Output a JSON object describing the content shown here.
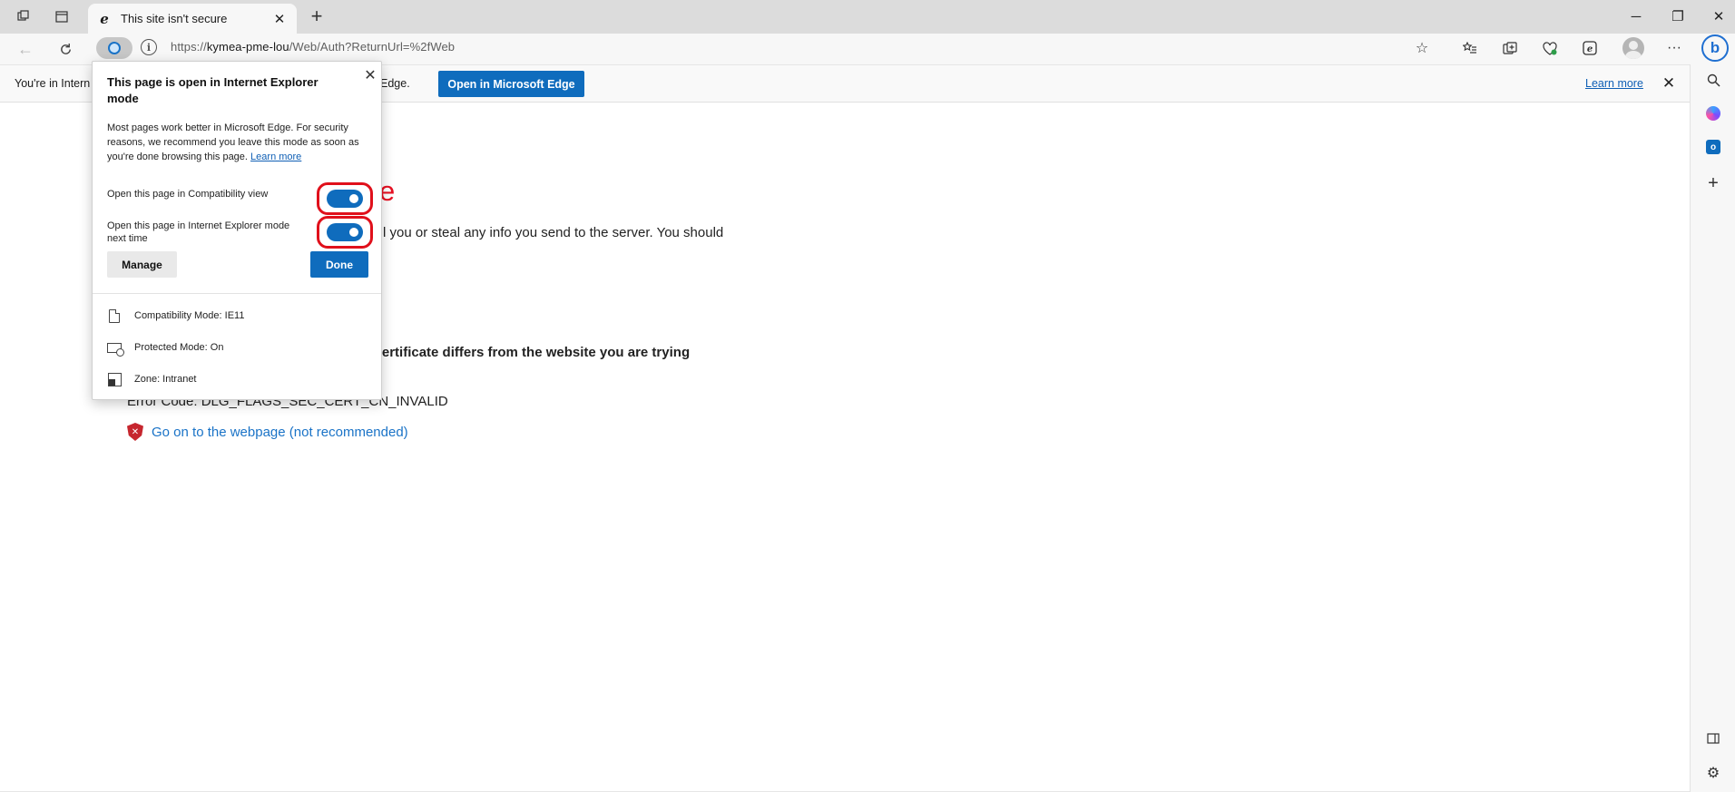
{
  "tab": {
    "title": "This site isn't secure",
    "close": "✕"
  },
  "window": {
    "minimize": "─",
    "restore": "❐",
    "close": "✕"
  },
  "address": {
    "prefix": "https://",
    "host": "kymea-pme-lou",
    "path": "/Web/Auth?ReturnUrl=%2fWeb"
  },
  "infobar": {
    "text_start": "You're in Intern",
    "text_end": "Edge.",
    "open_button": "Open in Microsoft Edge",
    "learn_more": "Learn more"
  },
  "popup": {
    "title": "This page is open in Internet Explorer mode",
    "description": "Most pages work better in Microsoft Edge. For security reasons, we recommend you leave this mode as soon as you're done browsing this page.",
    "learn_more": "Learn more",
    "option_compat": "Open this page in Compatibility view",
    "option_ie_next": "Open this page in Internet Explorer mode next time",
    "compat_on": true,
    "ie_next_on": true,
    "manage_button": "Manage",
    "done_button": "Done",
    "status": [
      {
        "icon": "document-icon",
        "label": "Compatibility Mode: IE11"
      },
      {
        "icon": "protected-mode-icon",
        "label": "Protected Mode: On"
      },
      {
        "icon": "zone-icon",
        "label": "Zone: Intranet"
      }
    ]
  },
  "page": {
    "heading_fragment": "e",
    "paragraph_fragment": "l you or steal any info you send to the server. You should",
    "bold_fragment": "y certificate differs from the website you are trying",
    "error_code": "Error Code: DLG_FLAGS_SEC_CERT_CN_INVALID",
    "go_on_link": "Go on to the webpage (not recommended)"
  },
  "colors": {
    "accent": "#0f6cbd",
    "error_red": "#e81123",
    "highlight_red": "#e0101b",
    "link": "#1a73c7"
  }
}
